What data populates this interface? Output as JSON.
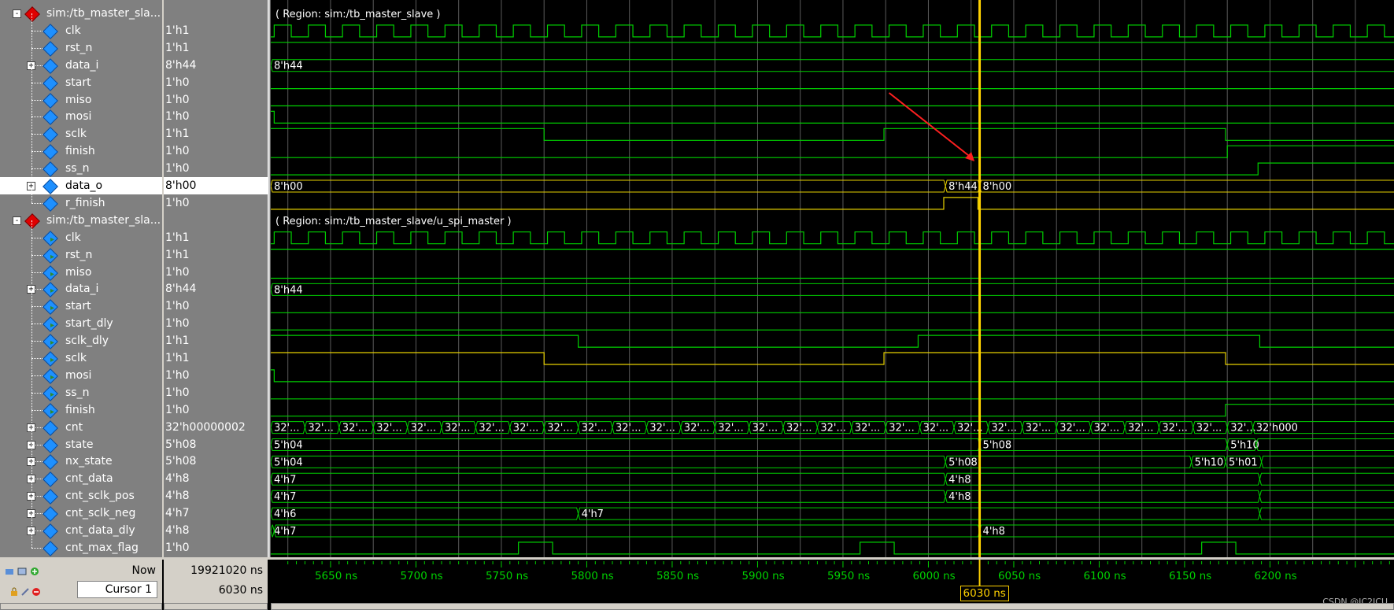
{
  "groups": [
    {
      "name": "sim:/tb_master_sla...",
      "region": "( Region: sim:/tb_master_slave )"
    },
    {
      "name": "sim:/tb_master_sla...",
      "region": "( Region: sim:/tb_master_slave/u_spi_master )"
    }
  ],
  "signals": [
    {
      "name": "clk",
      "value": "1'h1",
      "expand": false
    },
    {
      "name": "rst_n",
      "value": "1'h1",
      "expand": false
    },
    {
      "name": "data_i",
      "value": "8'h44",
      "expand": true
    },
    {
      "name": "start",
      "value": "1'h0",
      "expand": false
    },
    {
      "name": "miso",
      "value": "1'h0",
      "expand": false
    },
    {
      "name": "mosi",
      "value": "1'h0",
      "expand": false
    },
    {
      "name": "sclk",
      "value": "1'h1",
      "expand": false
    },
    {
      "name": "finish",
      "value": "1'h0",
      "expand": false
    },
    {
      "name": "ss_n",
      "value": "1'h0",
      "expand": false
    },
    {
      "name": "data_o",
      "value": "8'h00",
      "expand": true,
      "selected": true
    },
    {
      "name": "r_finish",
      "value": "1'h0",
      "expand": false
    },
    {
      "name": "clk",
      "value": "1'h1",
      "expand": false
    },
    {
      "name": "rst_n",
      "value": "1'h1",
      "expand": false
    },
    {
      "name": "miso",
      "value": "1'h0",
      "expand": false
    },
    {
      "name": "data_i",
      "value": "8'h44",
      "expand": true
    },
    {
      "name": "start",
      "value": "1'h0",
      "expand": false
    },
    {
      "name": "start_dly",
      "value": "1'h0",
      "expand": false
    },
    {
      "name": "sclk_dly",
      "value": "1'h1",
      "expand": false
    },
    {
      "name": "sclk",
      "value": "1'h1",
      "expand": false
    },
    {
      "name": "mosi",
      "value": "1'h0",
      "expand": false
    },
    {
      "name": "ss_n",
      "value": "1'h0",
      "expand": false
    },
    {
      "name": "finish",
      "value": "1'h0",
      "expand": false
    },
    {
      "name": "cnt",
      "value": "32'h00000002",
      "expand": true
    },
    {
      "name": "state",
      "value": "5'h08",
      "expand": true
    },
    {
      "name": "nx_state",
      "value": "5'h08",
      "expand": true
    },
    {
      "name": "cnt_data",
      "value": "4'h8",
      "expand": true
    },
    {
      "name": "cnt_sclk_pos",
      "value": "4'h8",
      "expand": true
    },
    {
      "name": "cnt_sclk_neg",
      "value": "4'h7",
      "expand": true
    },
    {
      "name": "cnt_data_dly",
      "value": "4'h8",
      "expand": true
    },
    {
      "name": "cnt_max_flag",
      "value": "1'h0",
      "expand": false
    }
  ],
  "bus_labels": {
    "data_i_1": "8'h44",
    "data_o_a": "8'h00",
    "data_o_b": "8'h44",
    "data_o_c": "8'h00",
    "data_i_2": "8'h44",
    "cnt_short": "32'...",
    "cnt_last": "32'h000",
    "state_a": "5'h04",
    "state_b": "5'h08",
    "state_c": "5'h10",
    "nx_a": "5'h04",
    "nx_b": "5'h08",
    "nx_c": "5'h10",
    "nx_d": "5'h01",
    "cd_a": "4'h7",
    "cd_b": "4'h8",
    "csp_a": "4'h7",
    "csp_b": "4'h8",
    "csn_a": "4'h6",
    "csn_b": "4'h7",
    "cdd_a": "4'h7",
    "cdd_b": "4'h8"
  },
  "footer": {
    "now_label": "Now",
    "now_value": "19921020 ns",
    "cursor_label": "Cursor 1",
    "cursor_value": "6030 ns"
  },
  "timeline": {
    "ticks": [
      "5650 ns",
      "5700 ns",
      "5750 ns",
      "5800 ns",
      "5850 ns",
      "5900 ns",
      "5950 ns",
      "6000 ns",
      "6050 ns",
      "6100 ns",
      "6150 ns",
      "6200 ns"
    ],
    "cursor_label": "6030 ns"
  },
  "watermark": "CSDN @IC2ICU",
  "colors": {
    "wave": "#00d000",
    "bus_yellow": "#e6d000",
    "cursor": "#ffd200",
    "arrow": "#ff2020"
  }
}
